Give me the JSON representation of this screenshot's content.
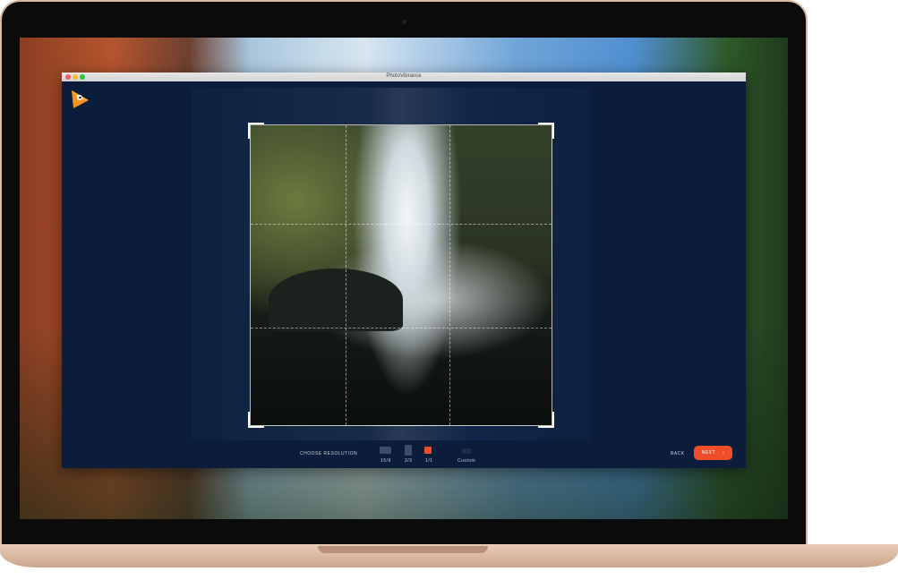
{
  "window": {
    "title": "PhotoVibrance"
  },
  "toolbar": {
    "choose_resolution": "CHOOSE RESOLUTION",
    "options": [
      {
        "label": "16/9"
      },
      {
        "label": "2/3"
      },
      {
        "label": "1/1",
        "selected": true
      },
      {
        "label": "Custom"
      }
    ],
    "back": "BACK",
    "next": "NEXT"
  },
  "colors": {
    "accent": "#f04e2a",
    "background": "#0b1d3a"
  }
}
